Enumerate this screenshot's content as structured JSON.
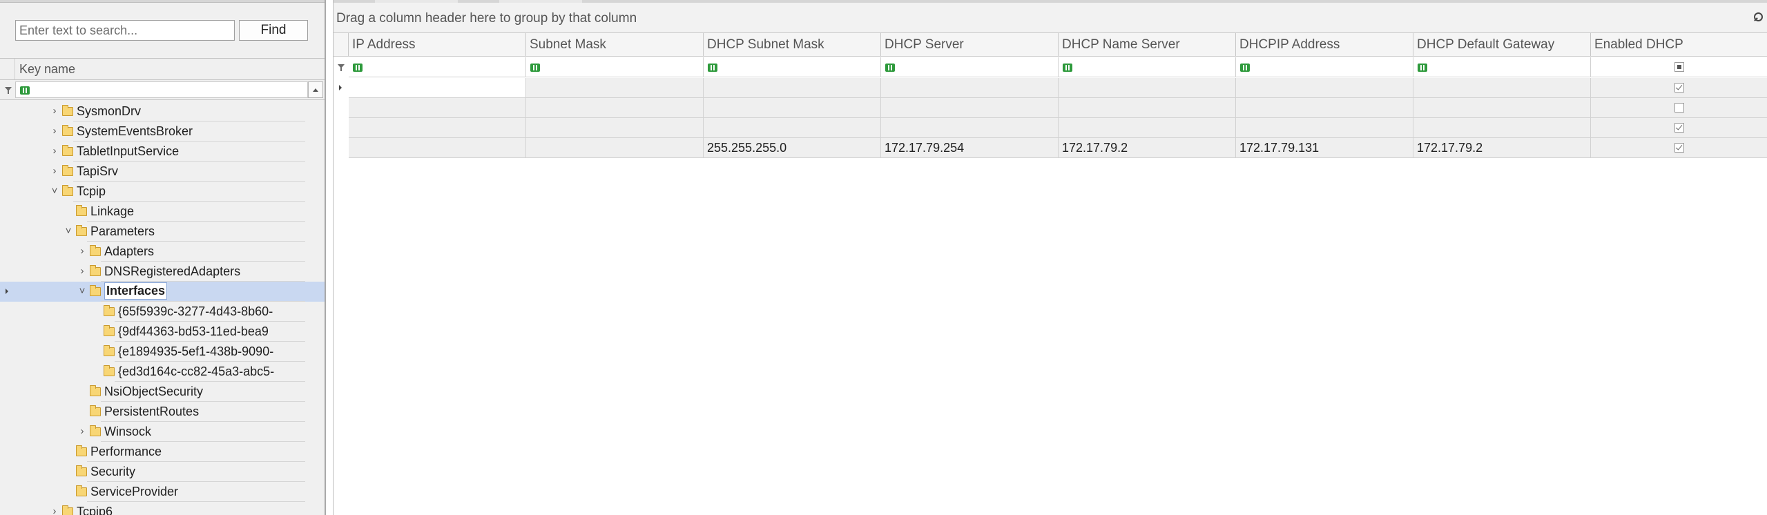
{
  "search": {
    "placeholder": "Enter text to search...",
    "find_label": "Find"
  },
  "tree": {
    "header": "Key name",
    "items": [
      {
        "label": "SysmonDrv",
        "level": 0,
        "expander": "collapsed"
      },
      {
        "label": "SystemEventsBroker",
        "level": 0,
        "expander": "collapsed"
      },
      {
        "label": "TabletInputService",
        "level": 0,
        "expander": "collapsed"
      },
      {
        "label": "TapiSrv",
        "level": 0,
        "expander": "collapsed"
      },
      {
        "label": "Tcpip",
        "level": 0,
        "expander": "expanded"
      },
      {
        "label": "Linkage",
        "level": 1,
        "expander": "none"
      },
      {
        "label": "Parameters",
        "level": 1,
        "expander": "expanded"
      },
      {
        "label": "Adapters",
        "level": 2,
        "expander": "collapsed"
      },
      {
        "label": "DNSRegisteredAdapters",
        "level": 2,
        "expander": "collapsed"
      },
      {
        "label": "Interfaces",
        "level": 2,
        "expander": "expanded",
        "selected": true
      },
      {
        "label": "{65f5939c-3277-4d43-8b60-",
        "level": 3,
        "expander": "none"
      },
      {
        "label": "{9df44363-bd53-11ed-bea9",
        "level": 3,
        "expander": "none"
      },
      {
        "label": "{e1894935-5ef1-438b-9090-",
        "level": 3,
        "expander": "none"
      },
      {
        "label": "{ed3d164c-cc82-45a3-abc5-",
        "level": 3,
        "expander": "none"
      },
      {
        "label": "NsiObjectSecurity",
        "level": 2,
        "expander": "none"
      },
      {
        "label": "PersistentRoutes",
        "level": 2,
        "expander": "none"
      },
      {
        "label": "Winsock",
        "level": 2,
        "expander": "collapsed"
      },
      {
        "label": "Performance",
        "level": 1,
        "expander": "none"
      },
      {
        "label": "Security",
        "level": 1,
        "expander": "none"
      },
      {
        "label": "ServiceProvider",
        "level": 1,
        "expander": "none"
      },
      {
        "label": "Tcpip6",
        "level": 0,
        "expander": "collapsed"
      }
    ]
  },
  "grid": {
    "group_hint": "Drag a column header here to group by that column",
    "columns": [
      "IP Address",
      "Subnet Mask",
      "DHCP Subnet Mask",
      "DHCP Server",
      "DHCP Name Server",
      "DHCPIP Address",
      "DHCP Default Gateway",
      "Enabled DHCP"
    ],
    "rows": [
      {
        "cells": [
          "",
          "",
          "",
          "",
          "",
          "",
          ""
        ],
        "enabled_dhcp": "checked"
      },
      {
        "cells": [
          "",
          "",
          "",
          "",
          "",
          "",
          ""
        ],
        "enabled_dhcp": "unchecked"
      },
      {
        "cells": [
          "",
          "",
          "",
          "",
          "",
          "",
          ""
        ],
        "enabled_dhcp": "checked"
      },
      {
        "cells": [
          "",
          "",
          "255.255.255.0",
          "172.17.79.254",
          "172.17.79.2",
          "172.17.79.131",
          "172.17.79.2"
        ],
        "enabled_dhcp": "checked"
      }
    ],
    "filter_enabled_dhcp": "indeterminate"
  }
}
